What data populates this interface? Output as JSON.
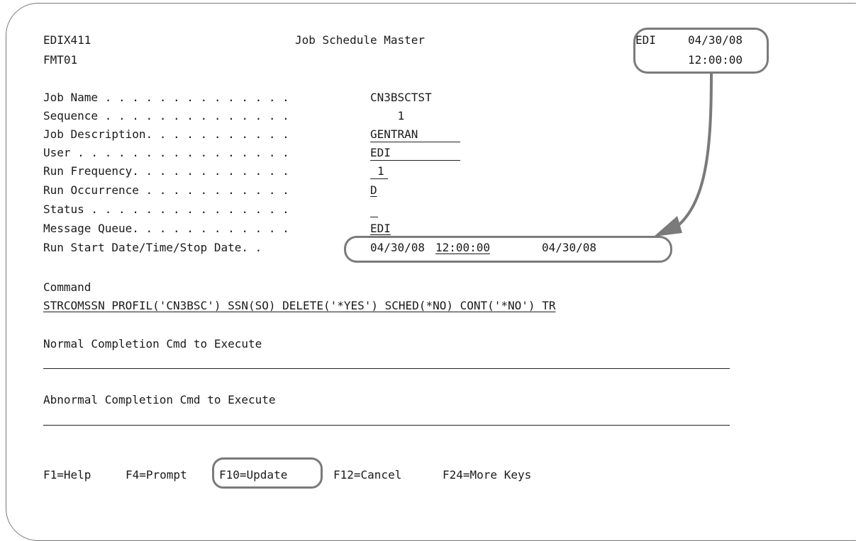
{
  "header": {
    "program": "EDIX411",
    "format": "FMT01",
    "title": "Job Schedule Master",
    "user_id": "EDI",
    "date": "04/30/08",
    "time": "12:00:00"
  },
  "fields": [
    {
      "label": "Job Name . . . . . . . . . . . . . .",
      "value": "CN3BSCTST"
    },
    {
      "label": "Sequence . . . . . . . . . . . . . .",
      "value": "    1"
    },
    {
      "label": "Job Description. . . . . . . . . . .",
      "value": "GENTRAN"
    },
    {
      "label": "User . . . . . . . . . . . . . . . .",
      "value": "EDI"
    },
    {
      "label": "Run Frequency. . . . . . . . . . . .",
      "value": "1"
    },
    {
      "label": "Run Occurrence . . . . . . . . . . .",
      "value": "D"
    },
    {
      "label": "Status . . . . . . . . . . . . . . .",
      "value": ""
    },
    {
      "label": "Message Queue. . . . . . . . . . . .",
      "value": "EDI"
    },
    {
      "label": "Run Start Date/Time/Stop Date. .",
      "start_date": "04/30/08",
      "start_time": "12:00:00",
      "stop_date": "04/30/08"
    }
  ],
  "command": {
    "label": "Command",
    "value": "STRCOMSSN PROFIL('CN3BSC') SSN(SO) DELETE('*YES') SCHED(*NO) CONT('*NO') TR"
  },
  "normal_cmd": {
    "label": "Normal Completion Cmd to Execute",
    "value": ""
  },
  "abnormal_cmd": {
    "label": "Abnormal Completion Cmd to Execute",
    "value": ""
  },
  "function_keys": {
    "f1": "F1=Help",
    "f4": "F4=Prompt",
    "f10": "F10=Update",
    "f12": "F12=Cancel",
    "f24": "F24=More Keys"
  },
  "colors": {
    "callout": "#7a7a7a",
    "text": "#1a1a1a"
  }
}
